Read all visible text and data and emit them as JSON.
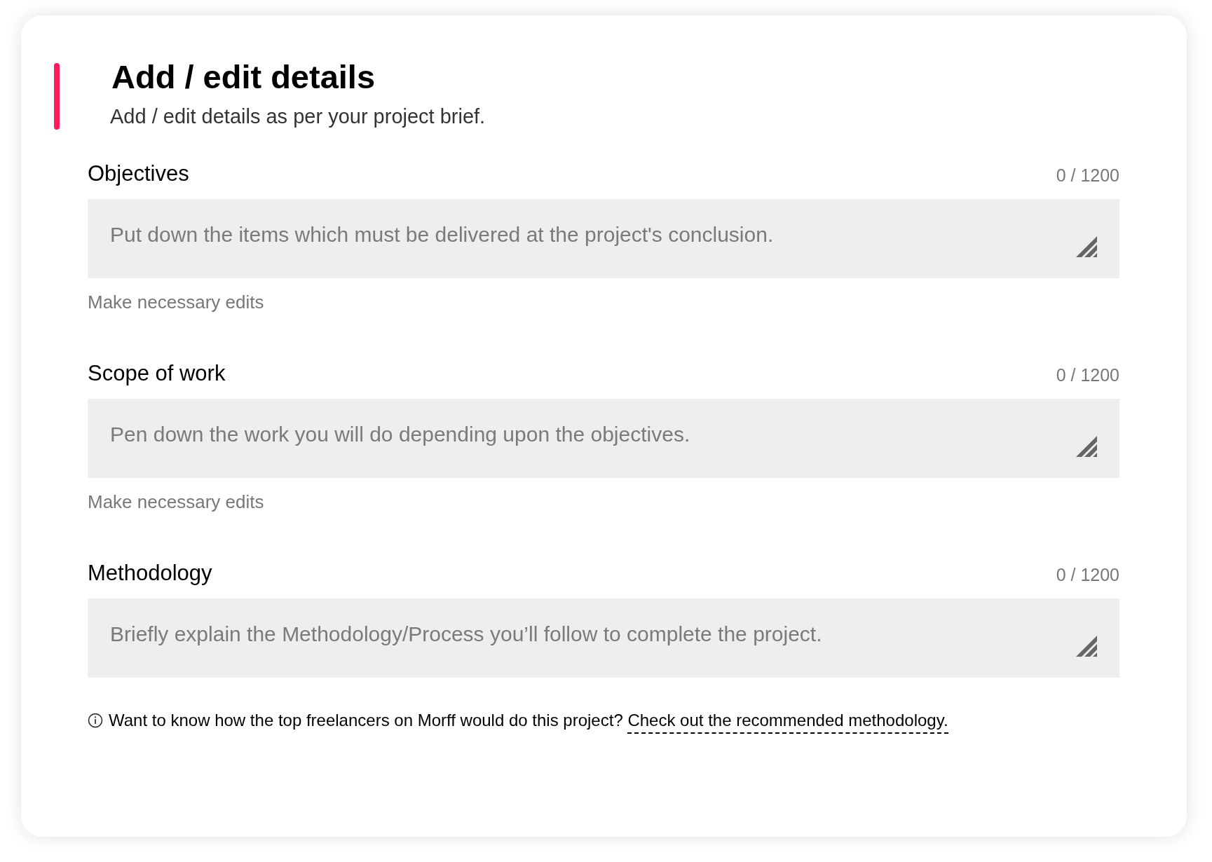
{
  "header": {
    "title": "Add / edit details",
    "subtitle": "Add / edit details as per your project brief."
  },
  "fields": [
    {
      "label": "Objectives",
      "counter": "0 / 1200",
      "placeholder": "Put down the items which must be delivered at the project's conclusion.",
      "helper": "Make necessary edits"
    },
    {
      "label": "Scope of work",
      "counter": "0 / 1200",
      "placeholder": "Pen down the work you will do depending upon the objectives.",
      "helper": "Make necessary edits"
    },
    {
      "label": "Methodology",
      "counter": "0 / 1200",
      "placeholder": "Briefly explain the Methodology/Process you’ll follow to complete the project."
    }
  ],
  "note": {
    "text": "Want to know how the top freelancers on Morff would do this project?",
    "link": "Check out the recommended methodology."
  }
}
